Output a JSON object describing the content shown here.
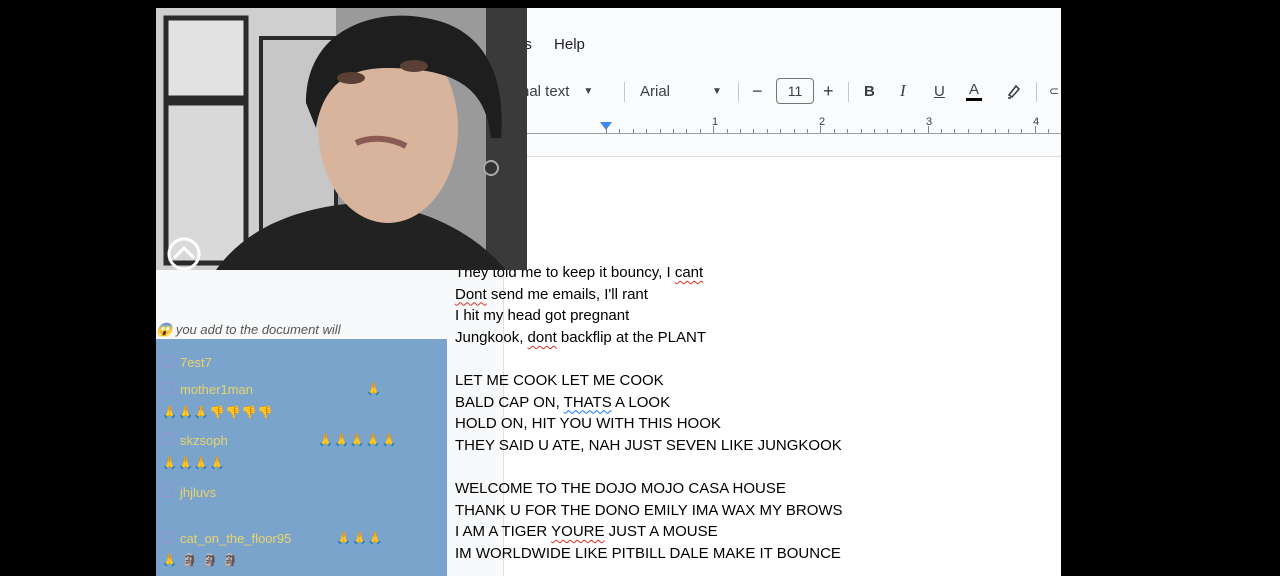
{
  "docs": {
    "menu": {
      "partial_item": "ns",
      "help": "Help"
    },
    "toolbar": {
      "style": "nal text",
      "font": "Arial",
      "minus": "−",
      "font_size": "11",
      "plus": "+",
      "bold": "B",
      "italic": "I",
      "underline": "U",
      "text_color": "A"
    },
    "ruler": {
      "marks": [
        "1",
        "2",
        "3",
        "4"
      ]
    },
    "lines": [
      "They told me to keep it bouncy, I cant",
      "Dont send me emails, I'll rant",
      "I hit my head got pregnant",
      "Jungkook, dont backflip at the PLANT",
      "",
      "LET ME COOK LET ME COOK",
      "BALD CAP ON, THATS A LOOK",
      "HOLD ON, HIT YOU WITH THIS HOOK",
      "THEY SAID U ATE, NAH JUST SEVEN LIKE JUNGKOOK",
      "",
      "WELCOME TO THE DOJO MOJO CASA HOUSE",
      "THANK U FOR THE DONO EMILY IMA WAX MY BROWS",
      "I AM A TIGER YOURE JUST A MOUSE",
      "IM WORLDWIDE LIKE PITBILL DALE MAKE IT BOUNCE"
    ]
  },
  "chat": {
    "header": "you add to the document will",
    "messages": [
      {
        "user": "7est7",
        "emotes": ""
      },
      {
        "user": "mother1man",
        "emotes": "🙏"
      },
      {
        "user": "skzsoph",
        "emotes": "🙏🙏🙏🙏🙏"
      },
      {
        "user": "jhjluvs",
        "emotes": ""
      },
      {
        "user": "cat_on_the_floor95",
        "emotes": "🙏🙏🙏"
      }
    ],
    "continuations": [
      "🙏🙏🙏👎👎👎👎",
      "🙏🙏🙏🙏",
      "🙏 🗿 🗿 🗿"
    ]
  },
  "colors": {
    "accent": "#4285f4",
    "chat_bg": "#7ba4cc",
    "chat_text": "#e9d36a"
  }
}
